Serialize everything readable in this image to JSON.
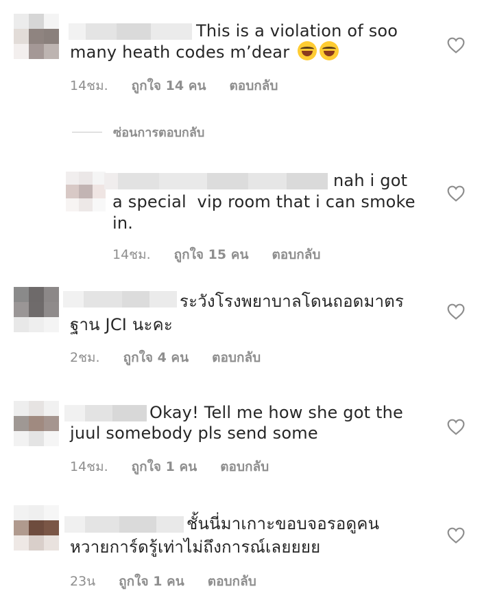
{
  "comments": [
    {
      "text_line1": "This is a violation of soo",
      "text_line2": "many heath codes m’dear",
      "time": "14ชม.",
      "likes": "ถูกใจ 14 คน",
      "reply": "ตอบกลับ"
    },
    {
      "text_line1": "nah i got",
      "text_line2": "a special  vip room that i can smoke",
      "text_line3": "in.",
      "time": "14ชม.",
      "likes": "ถูกใจ 15 คน",
      "reply": "ตอบกลับ"
    },
    {
      "text_line1": "ระวังโรงพยาบาลโดนถอดมาตร",
      "text_line2": "ฐาน JCI นะคะ",
      "time": "2ชม.",
      "likes": "ถูกใจ 4 คน",
      "reply": "ตอบกลับ"
    },
    {
      "text_line1": "Okay! Tell me how she got the",
      "text_line2": "juul somebody pls send some",
      "time": "14ชม.",
      "likes": "ถูกใจ 1 คน",
      "reply": "ตอบกลับ"
    },
    {
      "text_line1": "ชั้นนี่มาเกาะขอบจอรอดูคน",
      "text_line2": "หวายการ์ดรู้เท่าไม่ถึงการณ์เลยยยย",
      "time": "23น",
      "likes": "ถูกใจ 1 คน",
      "reply": "ตอบกลับ"
    }
  ],
  "hide_replies_label": "ซ่อนการตอบกลับ",
  "icons": {
    "like": "heart-outline-icon",
    "emoji": "face-with-tears-of-joy-icon"
  },
  "colors": {
    "text": "#262626",
    "meta": "#8e8e8e",
    "heart": "#8e8e8e"
  }
}
